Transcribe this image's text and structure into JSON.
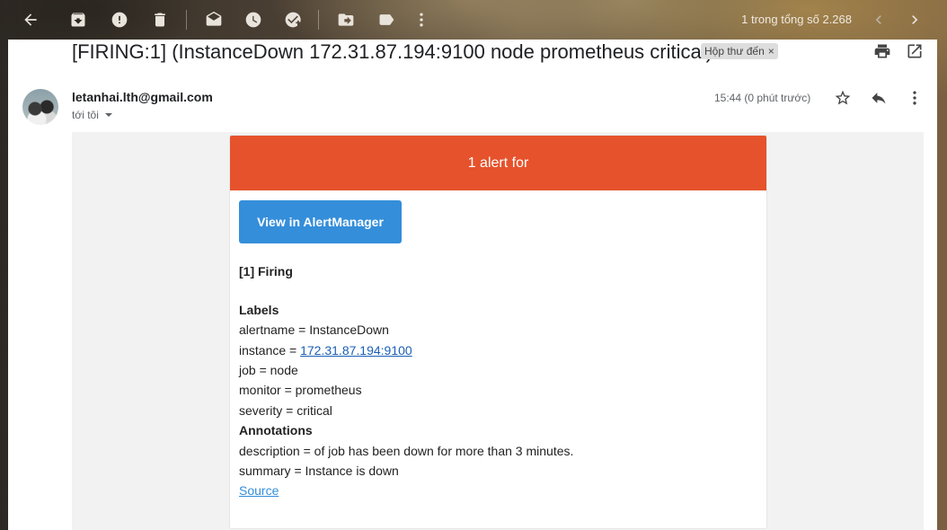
{
  "toolbar": {
    "icons": [
      "back-arrow-icon",
      "archive-icon",
      "report-spam-icon",
      "delete-icon",
      "mark-unread-icon",
      "snooze-icon",
      "add-to-tasks-icon",
      "move-to-icon",
      "label-icon",
      "more-vert-icon"
    ],
    "pager_text": "1 trong tổng số 2.268"
  },
  "message": {
    "subject": "[FIRING:1] (InstanceDown 172.31.87.194:9100 node prometheus critical)",
    "inbox_chip": "Hộp thư đến",
    "chip_close": "×",
    "sender": "letanhai.lth@gmail.com",
    "to_me": "tới tôi",
    "time": "15:44 (0 phút trước)"
  },
  "alert_card": {
    "header": "1 alert for",
    "button_label": "View in AlertManager",
    "firing": "[1] Firing",
    "labels_heading": "Labels",
    "alertname": "alertname = InstanceDown",
    "instance_prefix": "instance = ",
    "instance_link": "172.31.87.194:9100",
    "job": "job = node",
    "monitor": "monitor = prometheus",
    "severity": "severity = critical",
    "annotations_heading": "Annotations",
    "description": "description = of job has been down for more than 3 minutes.",
    "summary": "summary = Instance is down",
    "source_link": "Source"
  },
  "colors": {
    "alert_header": "#e6522c",
    "button": "#348eda",
    "link": "#1a5fb4"
  }
}
